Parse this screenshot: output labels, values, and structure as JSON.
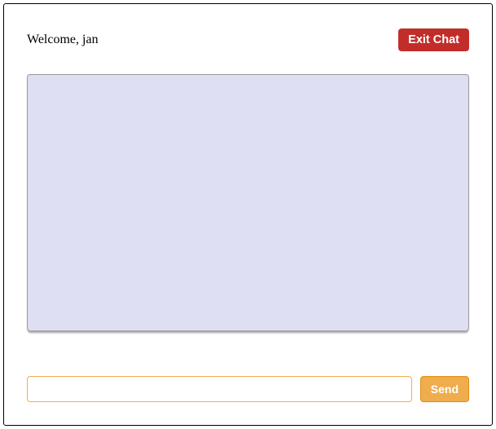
{
  "header": {
    "welcome_text": "Welcome, jan",
    "exit_label": "Exit Chat"
  },
  "chat": {
    "messages": []
  },
  "composer": {
    "input_value": "",
    "input_placeholder": "",
    "send_label": "Send"
  },
  "colors": {
    "exit_button_bg": "#c12e2a",
    "chat_area_bg": "#dedff2",
    "accent_orange": "#f0ad4e"
  }
}
